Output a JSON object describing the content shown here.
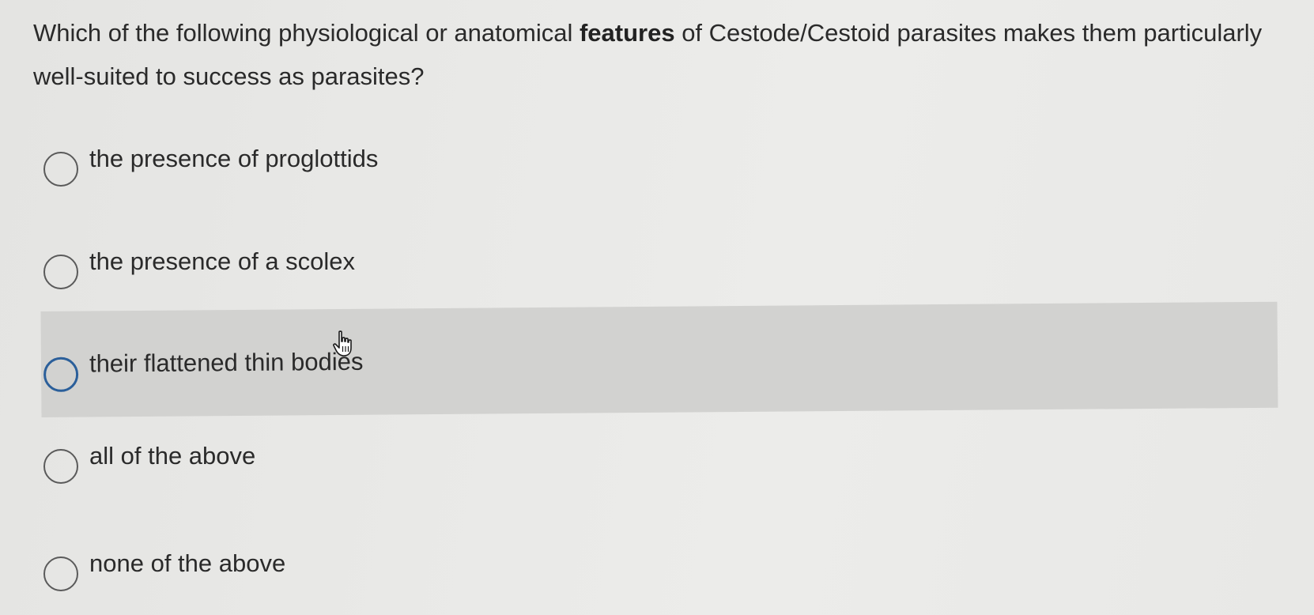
{
  "question": {
    "text_before": "Which of the following physiological or anatomical ",
    "text_bold": "features",
    "text_after": " of Cestode/Cestoid parasites makes them particularly well-suited to success as parasites?"
  },
  "options": [
    {
      "label": "the presence of proglottids",
      "selected": false,
      "hovered": false
    },
    {
      "label": "the presence of a scolex",
      "selected": false,
      "hovered": false
    },
    {
      "label": "their flattened thin bodies",
      "selected": false,
      "hovered": true
    },
    {
      "label": "all of the above",
      "selected": false,
      "hovered": false
    },
    {
      "label": "none of the above",
      "selected": false,
      "hovered": false
    }
  ],
  "icons": {
    "cursor": "hand-pointer-icon"
  },
  "colors": {
    "background": "#e9e9e7",
    "hover_background": "#d2d2d0",
    "hover_radio_border": "#2b5f9a",
    "radio_border": "#5a5a5a",
    "text": "#2a2a2a"
  }
}
